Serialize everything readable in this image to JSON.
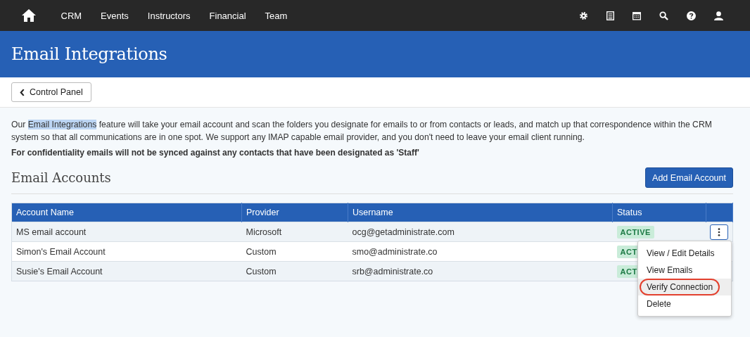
{
  "nav": {
    "items": [
      "CRM",
      "Events",
      "Instructors",
      "Financial",
      "Team"
    ]
  },
  "header": {
    "title": "Email Integrations"
  },
  "back_button": "Control Panel",
  "intro": {
    "before": "Our ",
    "highlight": "Email Integrations",
    "after": " feature will take your email account and scan the folders you designate for emails to or from contacts or leads, and match up that correspondence within the CRM system so that all communications are in one spot. We support any IMAP capable email provider, and you don't need to leave your email client running."
  },
  "note": "For confidentiality emails will not be synced against any contacts that have been designated as 'Staff'",
  "section_title": "Email Accounts",
  "add_button": "Add Email Account",
  "table": {
    "columns": [
      "Account Name",
      "Provider",
      "Username",
      "Status"
    ],
    "rows": [
      {
        "name": "MS email account",
        "provider": "Microsoft",
        "username": "ocg@getadministrate.com",
        "status": "ACTIVE",
        "menu_open": true
      },
      {
        "name": "Simon's Email Account",
        "provider": "Custom",
        "username": "smo@administrate.co",
        "status": "ACT",
        "menu_open": false
      },
      {
        "name": "Susie's Email Account",
        "provider": "Custom",
        "username": "srb@administrate.co",
        "status": "ACT",
        "menu_open": false
      }
    ]
  },
  "menu": {
    "items": [
      {
        "label": "View / Edit Details",
        "selected": false
      },
      {
        "label": "View Emails",
        "selected": false
      },
      {
        "label": "Verify Connection",
        "selected": true
      },
      {
        "label": "Delete",
        "selected": false
      }
    ]
  }
}
